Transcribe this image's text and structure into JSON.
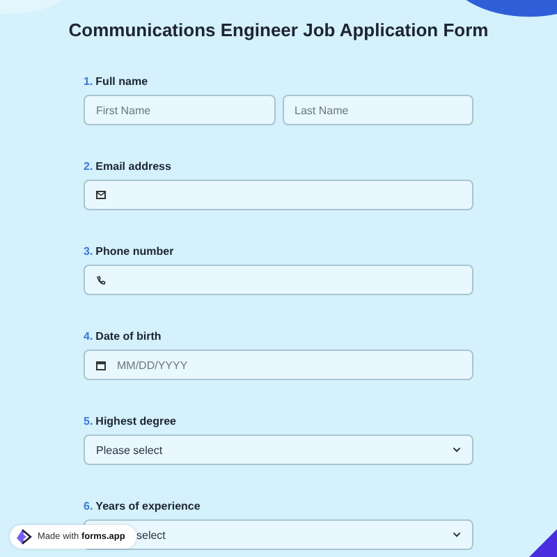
{
  "title": "Communications Engineer Job Application Form",
  "questions": [
    {
      "number": "1.",
      "label": "Full name",
      "kind": "name",
      "placeholders": [
        "First Name",
        "Last Name"
      ]
    },
    {
      "number": "2.",
      "label": "Email address",
      "kind": "email"
    },
    {
      "number": "3.",
      "label": "Phone number",
      "kind": "phone"
    },
    {
      "number": "4.",
      "label": "Date of birth",
      "kind": "date",
      "placeholder": "MM/DD/YYYY"
    },
    {
      "number": "5.",
      "label": "Highest degree",
      "kind": "select",
      "value": "Please select"
    },
    {
      "number": "6.",
      "label": "Years of experience",
      "kind": "select",
      "value": "select"
    }
  ],
  "badge": "Made with **forms.app**"
}
